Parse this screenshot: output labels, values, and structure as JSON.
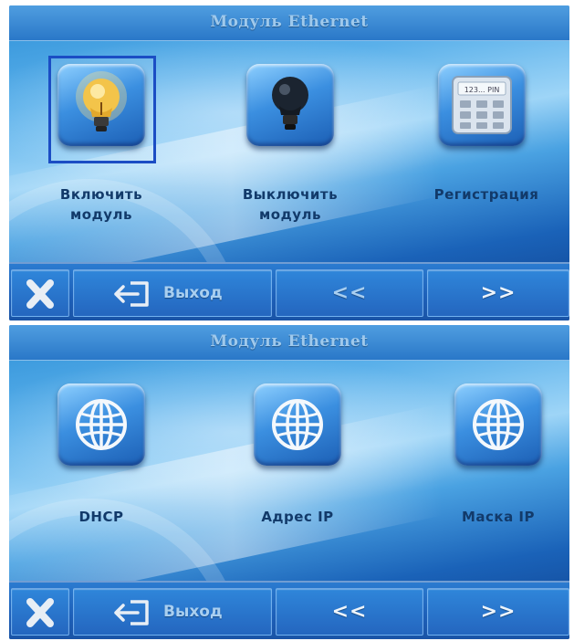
{
  "screens": [
    {
      "title": "Модуль Ethernet",
      "tiles": [
        {
          "label": "Включить модуль",
          "icon": "lightbulb-on-icon",
          "selected": true
        },
        {
          "label": "Выключить модуль",
          "icon": "lightbulb-off-icon",
          "selected": false
        },
        {
          "label": "Регистрация",
          "icon": "pin-keypad-icon",
          "selected": false,
          "icon_text": "123... PIN"
        }
      ],
      "bottom_bar": {
        "close_icon": "close-x-icon",
        "exit_label": "Выход",
        "exit_icon": "exit-door-icon",
        "prev_label": "<<",
        "next_label": ">>"
      }
    },
    {
      "title": "Модуль Ethernet",
      "tiles": [
        {
          "label": "DHCP",
          "icon": "globe-icon",
          "selected": false
        },
        {
          "label": "Адрес IP",
          "icon": "globe-icon",
          "selected": false
        },
        {
          "label": "Маска IP",
          "icon": "globe-icon",
          "selected": false
        }
      ],
      "bottom_bar": {
        "close_icon": "close-x-icon",
        "exit_label": "Выход",
        "exit_icon": "exit-door-icon",
        "prev_label": "<<",
        "next_label": ">>"
      }
    }
  ],
  "colors": {
    "selection_frame": "#1b4dc4",
    "label_text": "#123a6a",
    "title_text": "#9fc9ec",
    "bar_text": "#a9cff0"
  }
}
